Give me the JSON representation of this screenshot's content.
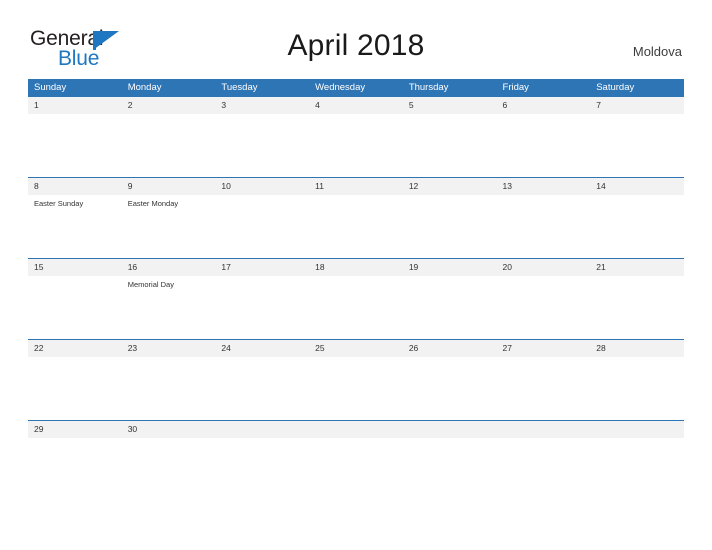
{
  "brand": {
    "name_part1": "General",
    "name_part2": "Blue",
    "flag_icon": "blue-triangle-flag-icon",
    "blue_hex": "#1f77c2"
  },
  "header": {
    "title": "April 2018",
    "country": "Moldova"
  },
  "theme": {
    "header_blue": "#2e75b6",
    "daynum_band": "#f2f2f2",
    "text": "#333333"
  },
  "weekdays": [
    "Sunday",
    "Monday",
    "Tuesday",
    "Wednesday",
    "Thursday",
    "Friday",
    "Saturday"
  ],
  "weeks": [
    [
      {
        "day": "1",
        "event": ""
      },
      {
        "day": "2",
        "event": ""
      },
      {
        "day": "3",
        "event": ""
      },
      {
        "day": "4",
        "event": ""
      },
      {
        "day": "5",
        "event": ""
      },
      {
        "day": "6",
        "event": ""
      },
      {
        "day": "7",
        "event": ""
      }
    ],
    [
      {
        "day": "8",
        "event": "Easter Sunday"
      },
      {
        "day": "9",
        "event": "Easter Monday"
      },
      {
        "day": "10",
        "event": ""
      },
      {
        "day": "11",
        "event": ""
      },
      {
        "day": "12",
        "event": ""
      },
      {
        "day": "13",
        "event": ""
      },
      {
        "day": "14",
        "event": ""
      }
    ],
    [
      {
        "day": "15",
        "event": ""
      },
      {
        "day": "16",
        "event": "Memorial Day"
      },
      {
        "day": "17",
        "event": ""
      },
      {
        "day": "18",
        "event": ""
      },
      {
        "day": "19",
        "event": ""
      },
      {
        "day": "20",
        "event": ""
      },
      {
        "day": "21",
        "event": ""
      }
    ],
    [
      {
        "day": "22",
        "event": ""
      },
      {
        "day": "23",
        "event": ""
      },
      {
        "day": "24",
        "event": ""
      },
      {
        "day": "25",
        "event": ""
      },
      {
        "day": "26",
        "event": ""
      },
      {
        "day": "27",
        "event": ""
      },
      {
        "day": "28",
        "event": ""
      }
    ],
    [
      {
        "day": "29",
        "event": ""
      },
      {
        "day": "30",
        "event": ""
      },
      {
        "day": "",
        "event": ""
      },
      {
        "day": "",
        "event": ""
      },
      {
        "day": "",
        "event": ""
      },
      {
        "day": "",
        "event": ""
      },
      {
        "day": "",
        "event": ""
      }
    ]
  ]
}
